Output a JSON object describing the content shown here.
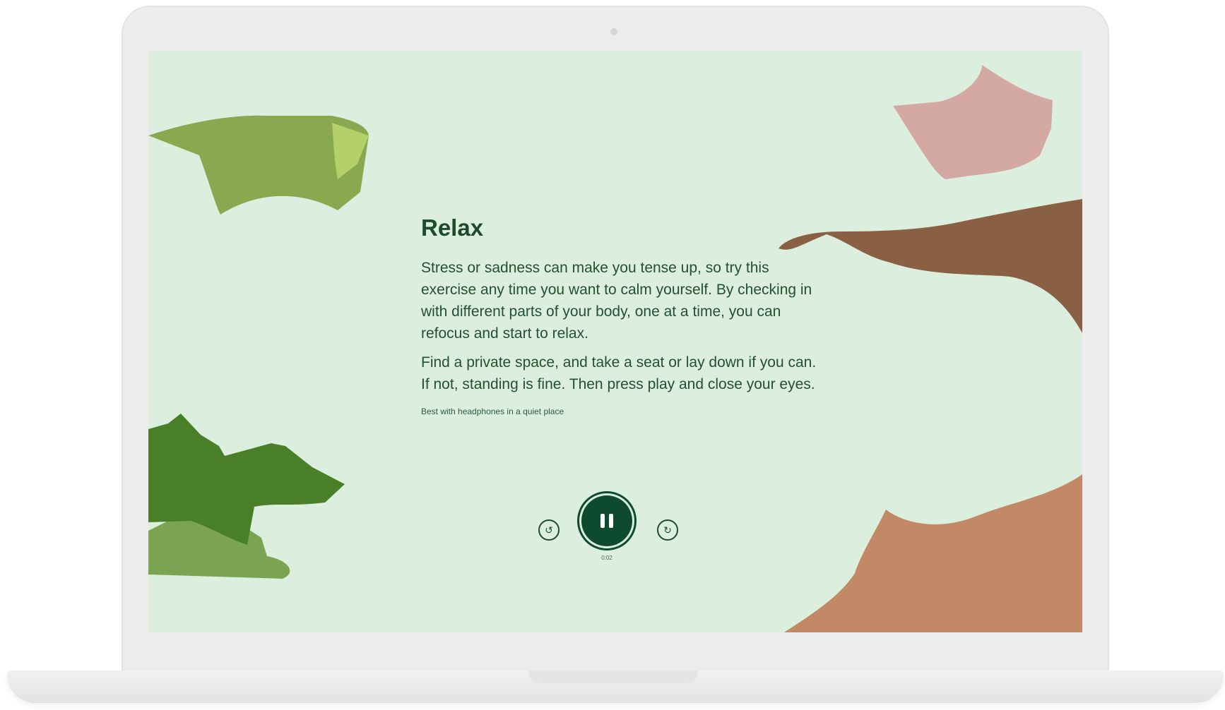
{
  "screen": {
    "title": "Relax",
    "paragraphs": [
      "Stress or sadness can make you tense up, so try this exercise any time you want to calm yourself. By checking in with different parts of your body, one at a time, you can refocus and start to relax.",
      "Find a private space, and take a seat or lay down if you can. If not, standing is fine. Then press play and close your eyes."
    ],
    "note": "Best with headphones in a quiet place"
  },
  "player": {
    "state": "playing",
    "time": "0:02",
    "skip_back_icon": "rewind-icon",
    "skip_forward_icon": "forward-icon",
    "pause_icon": "pause-icon"
  },
  "colors": {
    "background": "#dcefdf",
    "text": "#1e4b2c",
    "button": "#0d4a30",
    "green_light": "#8aa84f",
    "green_lime": "#b5d06a",
    "green_dark": "#4a7f2a",
    "green_mid": "#7aa452",
    "pink": "#d5a9a3",
    "brown": "#8a6045",
    "tan": "#c38966"
  }
}
